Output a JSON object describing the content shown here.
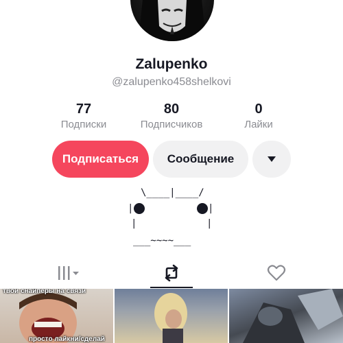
{
  "profile": {
    "name": "Zalupenko",
    "handle": "@zalupenko458shelkovi",
    "stats": [
      {
        "value": "77",
        "label": "Подписки"
      },
      {
        "value": "80",
        "label": "Подписчиков"
      },
      {
        "value": "0",
        "label": "Лайки"
      }
    ]
  },
  "actions": {
    "follow_label": "Подписаться",
    "message_label": "Сообщение",
    "more_icon": "caret-down-icon"
  },
  "bio": {
    "lines": [
      "\\____|____/",
      "|",
      "|",
      "|",
      "|",
      "___~~~~___"
    ]
  },
  "tabs": [
    {
      "name": "videos",
      "icon": "grid-bars-icon",
      "active": false
    },
    {
      "name": "reposts",
      "icon": "repost-icon",
      "active": true
    },
    {
      "name": "liked",
      "icon": "heart-outline-icon",
      "active": false
    }
  ],
  "thumbnails": [
    {
      "top_caption": "твои снайперы на связи",
      "bottom_caption": "просто лайкни/сделай"
    },
    {
      "top_caption": "",
      "bottom_caption": ""
    },
    {
      "top_caption": "",
      "bottom_caption": ""
    }
  ],
  "colors": {
    "accent": "#f5465d",
    "text": "#161823",
    "secondary_text": "#8a8b91",
    "button_gray": "#f1f1f2"
  }
}
